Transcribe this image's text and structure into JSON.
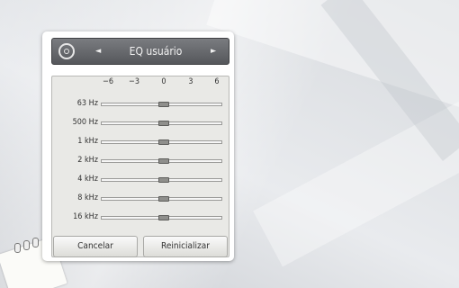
{
  "eq_panel": {
    "title": "EQ usuário",
    "arrow_left": "◄",
    "arrow_right": "►",
    "scale": [
      "−6",
      "−3",
      "0",
      "3",
      "6"
    ],
    "bands": [
      {
        "label": "63 Hz",
        "gain_db": 0
      },
      {
        "label": "500 Hz",
        "gain_db": 0
      },
      {
        "label": "1 kHz",
        "gain_db": 0
      },
      {
        "label": "2 kHz",
        "gain_db": 0
      },
      {
        "label": "4 kHz",
        "gain_db": 0
      },
      {
        "label": "8 kHz",
        "gain_db": 0
      },
      {
        "label": "16 kHz",
        "gain_db": 0
      }
    ],
    "buttons": {
      "cancel": "Cancelar",
      "reset": "Reinicializar"
    }
  },
  "icons": {
    "header_icon": "disc-icon",
    "nav_left": "left-arrow-icon",
    "nav_right": "right-arrow-icon",
    "decor": "notepad-icon"
  }
}
